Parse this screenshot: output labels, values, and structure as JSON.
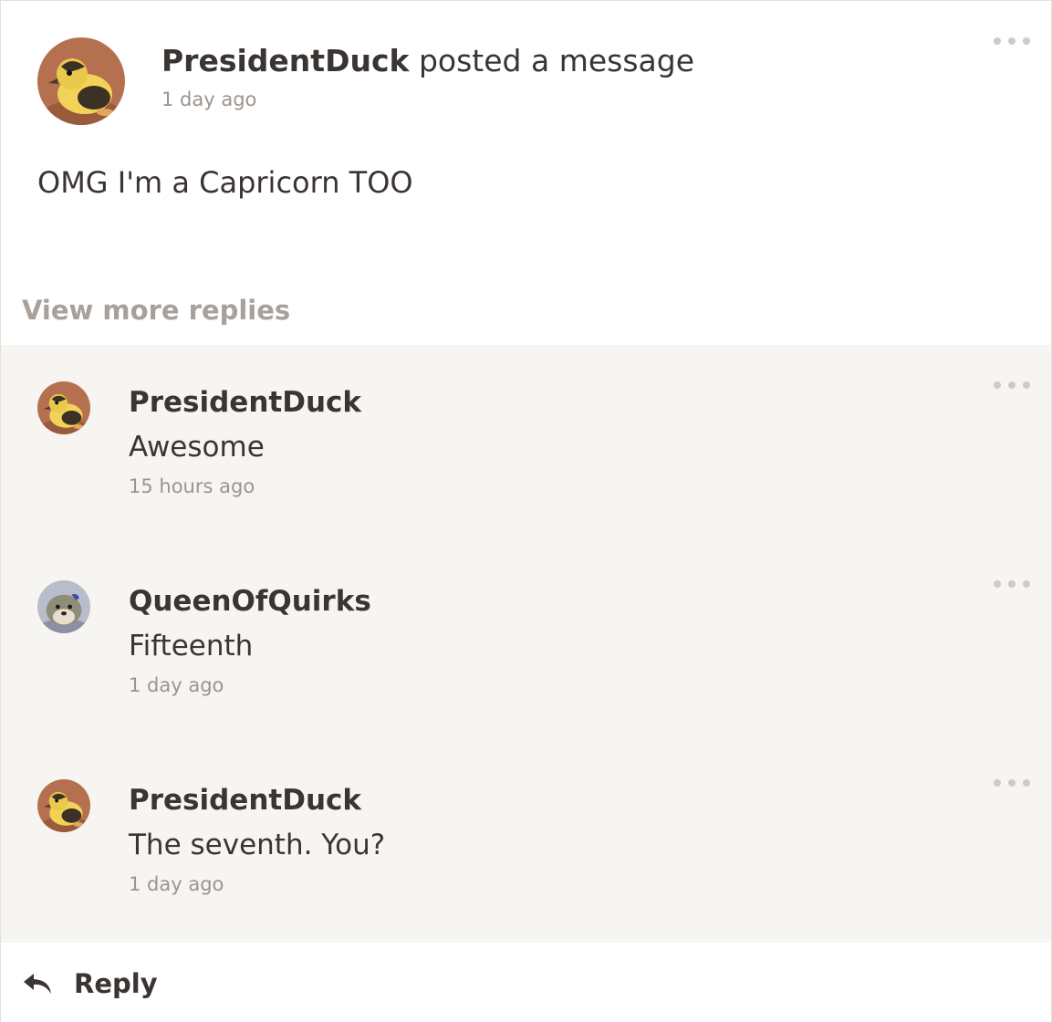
{
  "post": {
    "author": "PresidentDuck",
    "action": "posted a message",
    "time": "1 day ago",
    "message": "OMG I'm a Capricorn TOO",
    "avatar_icon": "duckling-avatar"
  },
  "view_more_replies_label": "View more replies",
  "replies": [
    {
      "author": "PresidentDuck",
      "text": "Awesome",
      "time": "15 hours ago",
      "avatar_icon": "duckling-avatar"
    },
    {
      "author": "QueenOfQuirks",
      "text": "Fifteenth",
      "time": "1 day ago",
      "avatar_icon": "plush-toy-avatar"
    },
    {
      "author": "PresidentDuck",
      "text": "The seventh. You?",
      "time": "1 day ago",
      "avatar_icon": "duckling-avatar"
    }
  ],
  "footer": {
    "reply_label": "Reply",
    "reply_icon": "reply-arrow-icon"
  },
  "colors": {
    "text": "#3a3532",
    "muted": "#9c948d",
    "link_muted": "#a8a09a",
    "replies_background": "#f7f5f1",
    "menu_dots": "#cfcac4"
  }
}
